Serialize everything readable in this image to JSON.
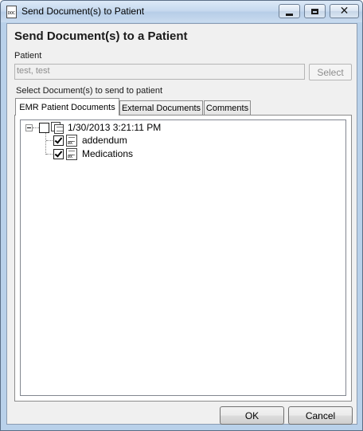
{
  "window": {
    "title": "Send Document(s) to  Patient",
    "icon": "document-icon",
    "icon_caption": "DOC"
  },
  "dialog": {
    "heading": "Send Document(s) to a Patient",
    "patient_label": "Patient",
    "patient_value": "test, test",
    "select_button": "Select",
    "documents_label": "Select Document(s) to send to patient"
  },
  "tabs": [
    {
      "label": "EMR Patient Documents",
      "active": true
    },
    {
      "label": "External Documents",
      "active": false
    },
    {
      "label": "Comments",
      "active": false
    }
  ],
  "tree": {
    "root": {
      "label": "1/30/2013 3:21:11 PM",
      "checked": false,
      "expanded": true
    },
    "children": [
      {
        "label": "addendum",
        "checked": true,
        "icon_caption": "DOC"
      },
      {
        "label": "Medications",
        "checked": true,
        "icon_caption": "DOC"
      }
    ]
  },
  "buttons": {
    "ok": "OK",
    "cancel": "Cancel"
  },
  "colors": {
    "frame": "#b9d1ea",
    "client": "#f0f0f0",
    "disabled_text": "#8d8d8d"
  }
}
